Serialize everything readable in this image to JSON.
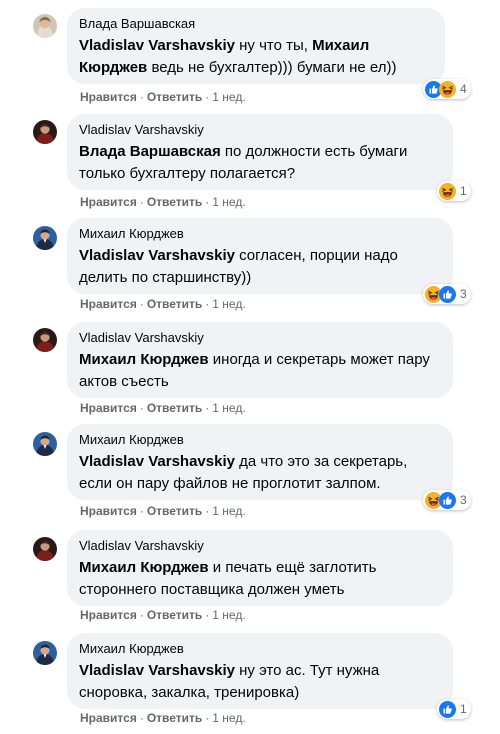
{
  "comments": [
    {
      "author": "Влада Варшавская",
      "mention": "Vladislav Varshavskiy",
      "text": " ну что ты, Михаил Кюрджев ведь не бухгалтер))) бумаги не ел))",
      "mention2": "Михаил Кюрджев",
      "text_a": " ну что ты, ",
      "text_b": " ведь не бухгалтер))) бумаги не ел))",
      "actions": {
        "like": "Нравится",
        "reply": "Ответить",
        "time": "1 нед."
      },
      "reactions": {
        "icons": [
          "like-icon",
          "haha-icon"
        ],
        "count": "4"
      },
      "avatar": "woman-photo"
    },
    {
      "author": "Vladislav Varshavskiy",
      "mention": "Влада Варшавская",
      "text": " по должности есть бумаги только бухгалтеру полагается?",
      "actions": {
        "like": "Нравится",
        "reply": "Ответить",
        "time": "1 нед."
      },
      "reactions": {
        "icons": [
          "haha-icon"
        ],
        "count": "1"
      },
      "avatar": "man-dark-photo"
    },
    {
      "author": "Михаил Кюрджев",
      "mention": "Vladislav Varshavskiy",
      "text": " согласен, порции надо делить по старшинству))",
      "actions": {
        "like": "Нравится",
        "reply": "Ответить",
        "time": "1 нед."
      },
      "reactions": {
        "icons": [
          "haha-icon",
          "like-icon"
        ],
        "count": "3"
      },
      "avatar": "man-blue-photo"
    },
    {
      "author": "Vladislav Varshavskiy",
      "mention": "Михаил Кюрджев",
      "text": " иногда и секретарь может пару актов съесть",
      "actions": {
        "like": "Нравится",
        "reply": "Ответить",
        "time": "1 нед."
      },
      "reactions": null,
      "avatar": "man-dark-photo"
    },
    {
      "author": "Михаил Кюрджев",
      "mention": "Vladislav Varshavskiy",
      "text": " да что это за секретарь, если он пару файлов не проглотит залпом.",
      "actions": {
        "like": "Нравится",
        "reply": "Ответить",
        "time": "1 нед."
      },
      "reactions": {
        "icons": [
          "haha-icon",
          "like-icon"
        ],
        "count": "3"
      },
      "avatar": "man-blue-photo"
    },
    {
      "author": "Vladislav Varshavskiy",
      "mention": "Михаил Кюрджев",
      "text": " и печать ещё заглотить стороннего поставщика должен уметь",
      "actions": {
        "like": "Нравится",
        "reply": "Ответить",
        "time": "1 нед."
      },
      "reactions": null,
      "avatar": "man-dark-photo"
    },
    {
      "author": "Михаил Кюрджев",
      "mention": "Vladislav Varshavskiy",
      "text": " ну это ас. Тут нужна сноровка, закалка, тренировка)",
      "actions": {
        "like": "Нравится",
        "reply": "Ответить",
        "time": "1 нед."
      },
      "reactions": {
        "icons": [
          "like-icon"
        ],
        "count": "1"
      },
      "avatar": "man-blue-photo"
    }
  ],
  "colors": {
    "bubble": "#f0f2f5",
    "meta": "#65676b",
    "like_blue": "#1877f2",
    "haha_yellow": "#f7b125"
  }
}
